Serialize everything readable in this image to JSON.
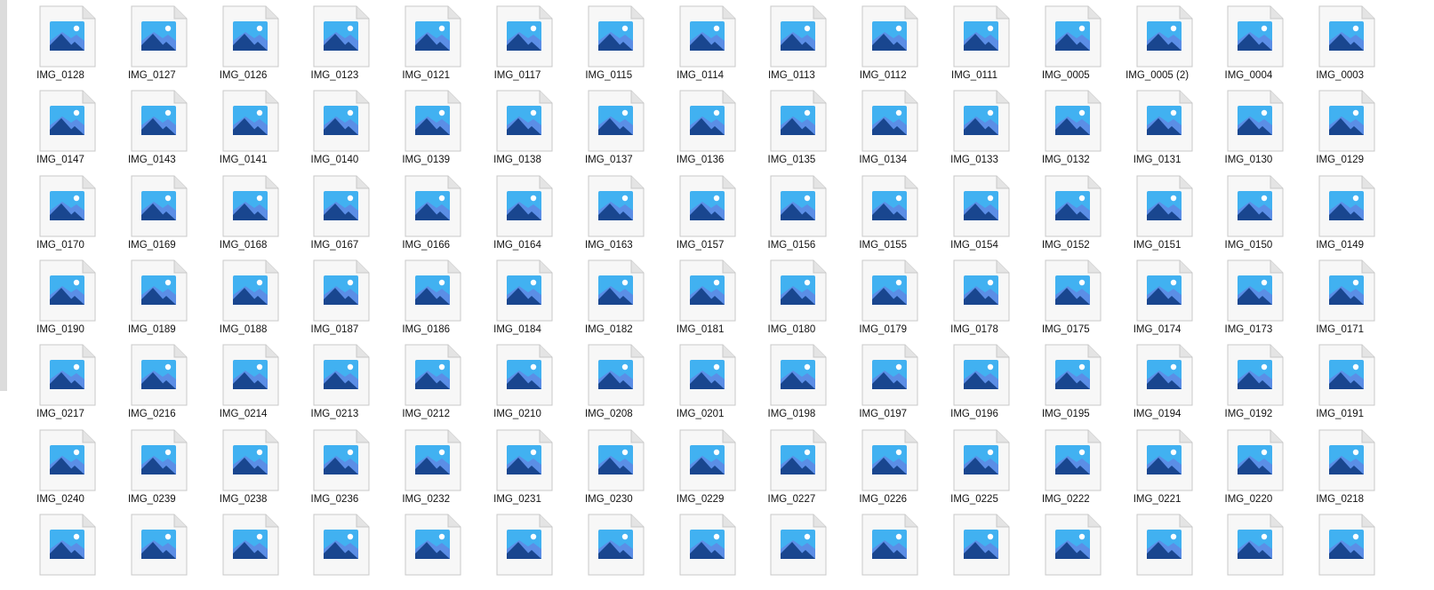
{
  "window": {
    "view_mode": "Large icons"
  },
  "icon": {
    "name": "image-file-icon",
    "colors": {
      "page": "#f7f7f7",
      "page_border": "#c8c8c8",
      "fold": "#e4e4e4",
      "frame_light": "#41b1f1",
      "frame_dark": "#1e90e0",
      "mountain_back": "#5b8ee6",
      "mountain_front": "#19468f",
      "sun": "#ffffff"
    }
  },
  "files": [
    [
      "IMG_0128",
      "IMG_0127",
      "IMG_0126",
      "IMG_0123",
      "IMG_0121",
      "IMG_0117",
      "IMG_0115",
      "IMG_0114",
      "IMG_0113",
      "IMG_0112",
      "IMG_0111",
      "IMG_0005",
      "IMG_0005 (2)",
      "IMG_0004",
      "IMG_0003"
    ],
    [
      "IMG_0147",
      "IMG_0143",
      "IMG_0141",
      "IMG_0140",
      "IMG_0139",
      "IMG_0138",
      "IMG_0137",
      "IMG_0136",
      "IMG_0135",
      "IMG_0134",
      "IMG_0133",
      "IMG_0132",
      "IMG_0131",
      "IMG_0130",
      "IMG_0129"
    ],
    [
      "IMG_0170",
      "IMG_0169",
      "IMG_0168",
      "IMG_0167",
      "IMG_0166",
      "IMG_0164",
      "IMG_0163",
      "IMG_0157",
      "IMG_0156",
      "IMG_0155",
      "IMG_0154",
      "IMG_0152",
      "IMG_0151",
      "IMG_0150",
      "IMG_0149"
    ],
    [
      "IMG_0190",
      "IMG_0189",
      "IMG_0188",
      "IMG_0187",
      "IMG_0186",
      "IMG_0184",
      "IMG_0182",
      "IMG_0181",
      "IMG_0180",
      "IMG_0179",
      "IMG_0178",
      "IMG_0175",
      "IMG_0174",
      "IMG_0173",
      "IMG_0171"
    ],
    [
      "IMG_0217",
      "IMG_0216",
      "IMG_0214",
      "IMG_0213",
      "IMG_0212",
      "IMG_0210",
      "IMG_0208",
      "IMG_0201",
      "IMG_0198",
      "IMG_0197",
      "IMG_0196",
      "IMG_0195",
      "IMG_0194",
      "IMG_0192",
      "IMG_0191"
    ],
    [
      "IMG_0240",
      "IMG_0239",
      "IMG_0238",
      "IMG_0236",
      "IMG_0232",
      "IMG_0231",
      "IMG_0230",
      "IMG_0229",
      "IMG_0227",
      "IMG_0226",
      "IMG_0225",
      "IMG_0222",
      "IMG_0221",
      "IMG_0220",
      "IMG_0218"
    ],
    [
      "",
      "",
      "",
      "",
      "",
      "",
      "",
      "",
      "",
      "",
      "",
      "",
      "",
      "",
      ""
    ]
  ],
  "scroll": {
    "arrow_glyph": "⌃"
  }
}
